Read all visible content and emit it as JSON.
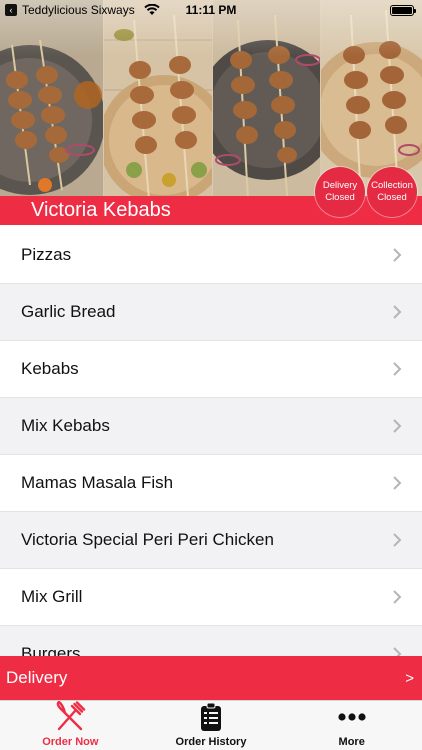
{
  "status_bar": {
    "back_app": "Teddylicious Sixways",
    "time": "11:11 PM",
    "icons": [
      "back-chevron-icon",
      "wifi-icon",
      "battery-icon"
    ]
  },
  "header": {
    "restaurant_name": "Victoria Kebabs",
    "badges": {
      "delivery": [
        "Delivery",
        "Closed"
      ],
      "collection": [
        "Collection",
        "Closed"
      ]
    }
  },
  "menu": {
    "categories": [
      "Pizzas",
      "Garlic Bread",
      "Kebabs",
      "Mix Kebabs",
      "Mamas Masala Fish",
      "Victoria Special Peri Peri Chicken",
      "Mix Grill",
      "Burgers"
    ]
  },
  "delivery_bar": {
    "label": "Delivery",
    "arrow": ">"
  },
  "tabs": [
    {
      "label": "Order Now",
      "icon": "fork-knife-icon"
    },
    {
      "label": "Order History",
      "icon": "clipboard-list-icon"
    },
    {
      "label": "More",
      "icon": "more-dots-icon"
    }
  ],
  "colors": {
    "accent": "#ee2d45",
    "alt_row": "#f2f2f4"
  }
}
